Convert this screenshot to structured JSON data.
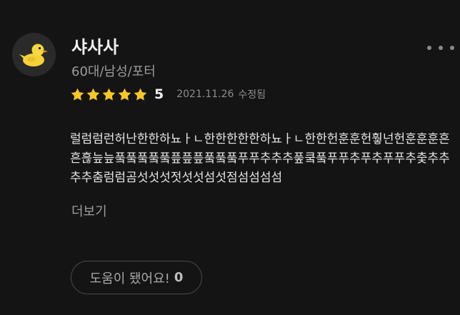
{
  "review": {
    "author_name": "샤사사",
    "author_meta": "60대/남성/포터",
    "rating": 5,
    "rating_label": "5",
    "date": "2021.11.26",
    "edited_label": "수정됨",
    "body": "럴럼럼런허난한한하뇨ㅏㄴ한한한한한하뇨ㅏㄴ한한헌훈훈헌훻넌헌훈훈훈흔흔흖늪늪풐풐풐풐풐픞픞픞풐풐풐푸푸추추추풒쿸풐푸푸추푸추푸푸추춫추추추추춤럼럼곰섯섯섯젓섯섯섬섯점섬섬섬섬",
    "read_more_label": "더보기",
    "helpful_label": "도움이 됐어요!",
    "helpful_count": "0"
  },
  "icons": {
    "avatar": "rubber-duck-avatar",
    "more": "more-horizontal-icon",
    "star": "star-icon"
  },
  "colors": {
    "background": "#141414",
    "star": "#f7c724",
    "primary_text": "#e6e6e6",
    "secondary_text": "#9c9c9c"
  }
}
